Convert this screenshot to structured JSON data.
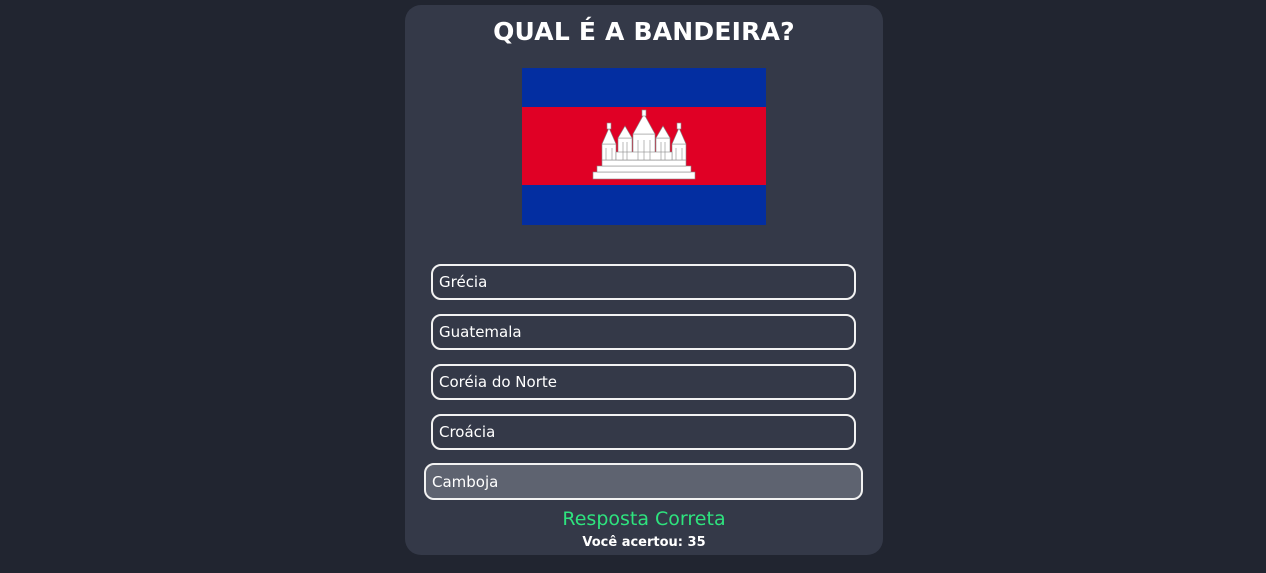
{
  "quiz": {
    "title": "QUAL É A BANDEIRA?",
    "flag_icon": "cambodia-flag-icon",
    "options": [
      {
        "label": "Grécia"
      },
      {
        "label": "Guatemala"
      },
      {
        "label": "Coréia do Norte"
      },
      {
        "label": "Croácia"
      },
      {
        "label": "Camboja",
        "selected": true
      }
    ],
    "result": "Resposta Correta",
    "score_label": "Você acertou:",
    "score_value": "35"
  },
  "colors": {
    "background": "#212530",
    "card": "#343948",
    "selected_option": "#5e6370",
    "correct": "#2ee37e",
    "flag_blue": "#032ea1",
    "flag_red": "#e00025"
  }
}
